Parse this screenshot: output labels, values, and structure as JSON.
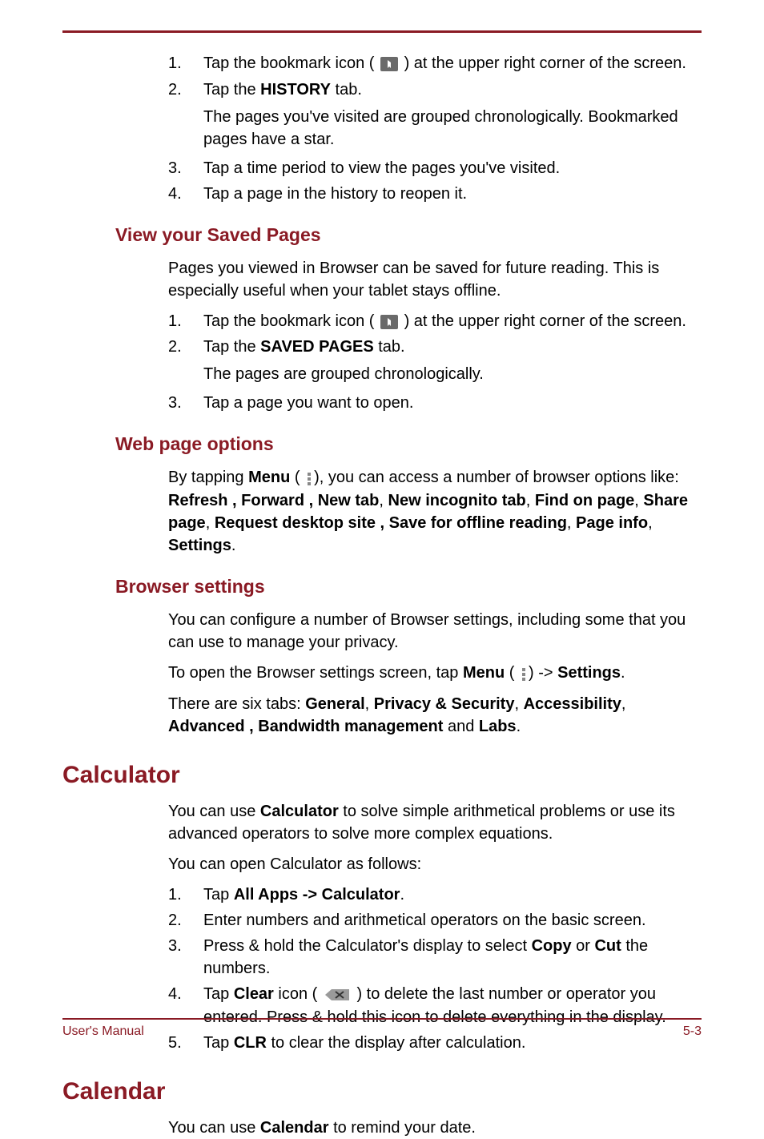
{
  "history_list": {
    "item1_a": "Tap the bookmark icon (",
    "item1_b": ") at the upper right corner of the screen.",
    "item2_a": "Tap the ",
    "item2_b": "HISTORY",
    "item2_c": " tab.",
    "item2_sub": "The pages you've visited are grouped chronologically. Bookmarked pages have a star.",
    "item3": "Tap a time period to view the pages you've visited.",
    "item4": "Tap a page in the history to reopen it."
  },
  "h_view_saved": "View your Saved Pages",
  "saved_intro": "Pages you viewed in Browser can be saved for future reading. This is especially useful when your tablet stays offline.",
  "saved_list": {
    "item1_a": "Tap the bookmark icon (",
    "item1_b": ") at the upper right corner of the screen.",
    "item2_a": "Tap the ",
    "item2_b": "SAVED PAGES",
    "item2_c": " tab.",
    "item2_sub": "The pages are grouped chronologically.",
    "item3": "Tap a page you want to open."
  },
  "h_web_options": "Web page options",
  "web_options": {
    "a": "By tapping ",
    "menu": "Menu",
    "b": " (",
    "c": "), you can access a number of browser options like: ",
    "opts": "Refresh , Forward , New tab",
    "sep1": ", ",
    "opt2": "New incognito tab",
    "sep2": ", ",
    "opt3": "Find on page",
    "sep3": ", ",
    "opt4": "Share page",
    "sep4": ", ",
    "opt5": "Request desktop site , Save for offline reading",
    "sep5": ", ",
    "opt6": "Page info",
    "sep6": ", ",
    "opt7": "Settings",
    "end": "."
  },
  "h_browser_settings": "Browser settings",
  "bs_p1": "You can configure a number of Browser settings, including some that you can use to manage your privacy.",
  "bs_p2": {
    "a": "To open the Browser settings screen, tap ",
    "menu": "Menu",
    "b": " (",
    "c": ") -> ",
    "settings": "Settings",
    "d": "."
  },
  "bs_p3": {
    "a": "There are six tabs: ",
    "t1": "General",
    "s1": ", ",
    "t2": "Privacy & Security",
    "s2": ", ",
    "t3": "Accessibility",
    "s3": ", ",
    "t4": "Advanced , Bandwidth management",
    "s4": " and ",
    "t5": "Labs",
    "d": "."
  },
  "h_calculator": "Calculator",
  "calc_p1": {
    "a": "You can use ",
    "b": "Calculator",
    "c": " to solve simple arithmetical problems or use its advanced operators to solve more complex equations."
  },
  "calc_p2": "You can open Calculator as follows:",
  "calc_list": {
    "item1_a": "Tap ",
    "item1_b": "All Apps -> Calculator",
    "item1_c": ".",
    "item2": "Enter numbers and arithmetical operators on the basic screen.",
    "item3_a": "Press & hold the Calculator's display to select ",
    "item3_b": "Copy",
    "item3_c": " or ",
    "item3_d": "Cut",
    "item3_e": " the numbers.",
    "item4_a": "Tap ",
    "item4_b": "Clear",
    "item4_c": " icon (",
    "item4_d": ") to delete the last number or operator you entered. Press & hold this icon to delete everything in the display.",
    "item5_a": "Tap ",
    "item5_b": "CLR",
    "item5_c": " to clear the display after calculation."
  },
  "h_calendar": "Calendar",
  "cal_p1": {
    "a": "You can use ",
    "b": "Calendar",
    "c": " to remind your date."
  },
  "footer": {
    "left": "User's Manual",
    "right": "5-3"
  },
  "nums": {
    "n1": "1.",
    "n2": "2.",
    "n3": "3.",
    "n4": "4.",
    "n5": "5."
  }
}
